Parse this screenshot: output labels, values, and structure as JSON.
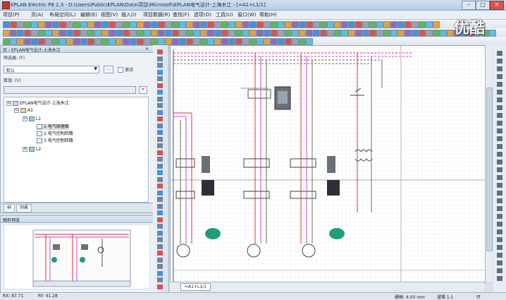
{
  "window": {
    "title": "EPLAN Electric P8 2.3 - D:\\Users\\Public\\EPLAN\\Data\\项目\\Microsoft\\EPLAN电气设计-上海木江 - [=A1+L1/1]",
    "minimize": "–",
    "maximize": "□",
    "close": "✕"
  },
  "menubar": {
    "items": [
      "项目(P)",
      "页(A)",
      "布局空间(L)",
      "编辑(E)",
      "视图(V)",
      "插入(I)",
      "项目数据(R)",
      "查找(F)",
      "选项(O)",
      "工具(U)",
      "窗口(W)",
      "帮助(H)"
    ]
  },
  "nav_panel": {
    "header": "页 - EPLAN电气设计-上海木江",
    "filter_label": "筛选器: (F)",
    "filter_value": "默认",
    "filter_browse": "...",
    "activate_label": "激活",
    "value_label": "数值: (V)",
    "value_btn": "»",
    "tree": [
      {
        "label": "EPLAN电气设计-上海木江",
        "expander": "⊟"
      },
      {
        "label": "A1",
        "expander": "⊟"
      },
      {
        "label": "L1",
        "expander": "⊟"
      },
      {
        "label": "1 电气原理图"
      },
      {
        "label": "2 电气控制回路"
      },
      {
        "label": "3 电气控制回路"
      },
      {
        "label": "L2",
        "expander": "⊞"
      }
    ],
    "tabs": [
      "树",
      "列表"
    ]
  },
  "preview_panel": {
    "header": "图形预览"
  },
  "canvas": {
    "page_tab": "=A1+L1/1"
  },
  "statusbar": {
    "rx": "RX: 87.71",
    "ry": "RY: 41.28",
    "grid": "栅格: 4.00 mm",
    "scale": "逻辑 1:1",
    "mode": "开"
  },
  "watermark": "优酷",
  "colors": {
    "title_bar": "#b8cfe8",
    "canvas_bg": "#ffffff",
    "wire_red": "#e0303a",
    "wire_magenta": "#c94ad6",
    "wire_dark": "#6b6b6b",
    "motor_green": "#1e9e7a"
  }
}
